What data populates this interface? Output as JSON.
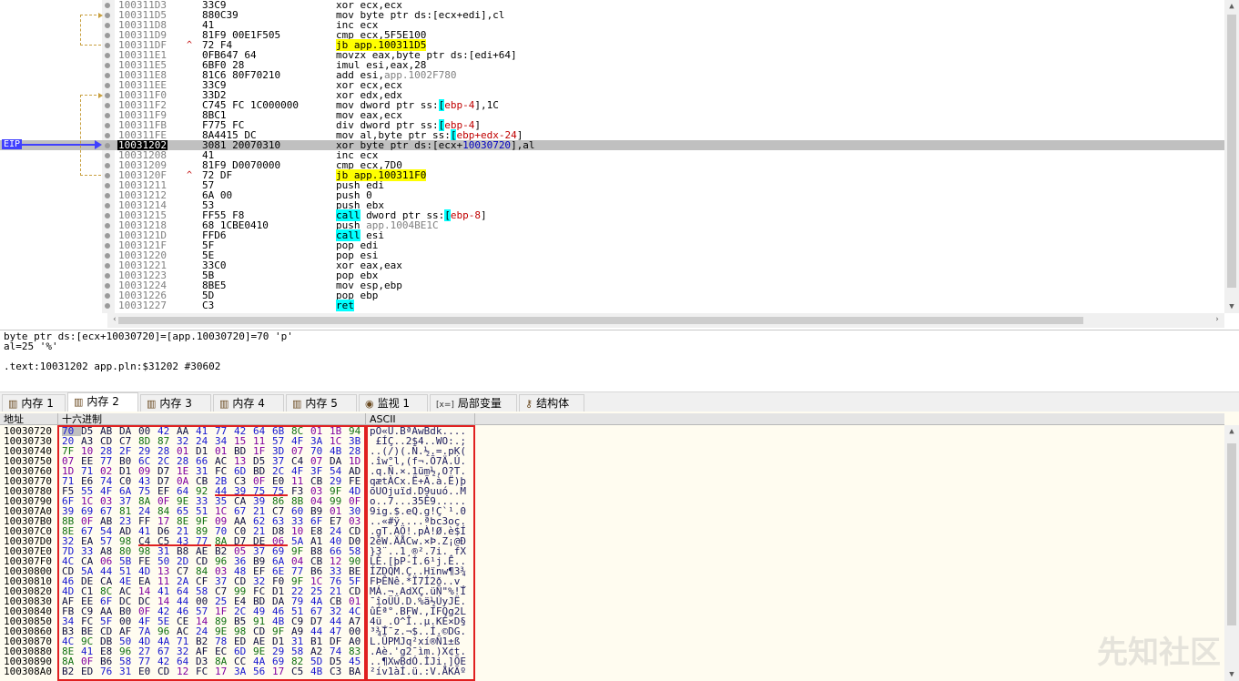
{
  "disasm": {
    "eip_label": "EIP",
    "rows": [
      {
        "addr": "100311D3",
        "bytes": "33C9",
        "asm": [
          {
            "t": "xor ecx,ecx"
          }
        ]
      },
      {
        "addr": "100311D5",
        "bytes": "880C39",
        "asm": [
          {
            "t": "mov byte ptr ds:[ecx+edi],cl"
          }
        ]
      },
      {
        "addr": "100311D8",
        "bytes": "41",
        "asm": [
          {
            "t": "inc ecx"
          }
        ]
      },
      {
        "addr": "100311D9",
        "bytes": "81F9 00E1F505",
        "asm": [
          {
            "t": "cmp ecx,5F5E100"
          }
        ]
      },
      {
        "addr": "100311DF",
        "bytes": "72 F4",
        "asm": [
          {
            "t": "jb app.100311D5",
            "c": "hl-y"
          }
        ],
        "jump": true
      },
      {
        "addr": "100311E1",
        "bytes": "0FB647 64",
        "asm": [
          {
            "t": "movzx eax,byte ptr ds:[edi+64]"
          }
        ]
      },
      {
        "addr": "100311E5",
        "bytes": "6BF0 28",
        "asm": [
          {
            "t": "imul esi,eax,28"
          }
        ]
      },
      {
        "addr": "100311E8",
        "bytes": "81C6 80F70210",
        "asm": [
          {
            "t": "add esi,"
          },
          {
            "t": "app.1002F780",
            "c": "col-gray"
          }
        ]
      },
      {
        "addr": "100311EE",
        "bytes": "33C9",
        "asm": [
          {
            "t": "xor ecx,ecx"
          }
        ]
      },
      {
        "addr": "100311F0",
        "bytes": "33D2",
        "asm": [
          {
            "t": "xor edx,edx"
          }
        ]
      },
      {
        "addr": "100311F2",
        "bytes": "C745 FC 1C000000",
        "asm": [
          {
            "t": "mov dword ptr ss:"
          },
          {
            "t": "[",
            "c": "hl-c"
          },
          {
            "t": "ebp-4",
            "c": "col-r"
          },
          {
            "t": "],1C"
          }
        ]
      },
      {
        "addr": "100311F9",
        "bytes": "8BC1",
        "asm": [
          {
            "t": "mov eax,ecx"
          }
        ]
      },
      {
        "addr": "100311FB",
        "bytes": "F775 FC",
        "asm": [
          {
            "t": "div dword ptr ss:"
          },
          {
            "t": "[",
            "c": "hl-c"
          },
          {
            "t": "ebp-4",
            "c": "col-r"
          },
          {
            "t": "]"
          }
        ]
      },
      {
        "addr": "100311FE",
        "bytes": "8A4415 DC",
        "asm": [
          {
            "t": "mov al,byte ptr ss:"
          },
          {
            "t": "[",
            "c": "hl-c"
          },
          {
            "t": "ebp+edx-24",
            "c": "col-r"
          },
          {
            "t": "]"
          }
        ]
      },
      {
        "addr": "10031202",
        "bytes": "3081 20070310",
        "asm": [
          {
            "t": "xor byte ptr ds:[ecx+"
          },
          {
            "t": "10030720",
            "c": "col-b"
          },
          {
            "t": "],al"
          }
        ],
        "eip": true
      },
      {
        "addr": "10031208",
        "bytes": "41",
        "asm": [
          {
            "t": "inc ecx"
          }
        ]
      },
      {
        "addr": "10031209",
        "bytes": "81F9 D0070000",
        "asm": [
          {
            "t": "cmp ecx,7D0"
          }
        ]
      },
      {
        "addr": "1003120F",
        "bytes": "72 DF",
        "asm": [
          {
            "t": "jb app.100311F0",
            "c": "hl-y"
          }
        ],
        "jump": true
      },
      {
        "addr": "10031211",
        "bytes": "57",
        "asm": [
          {
            "t": "push edi"
          }
        ]
      },
      {
        "addr": "10031212",
        "bytes": "6A 00",
        "asm": [
          {
            "t": "push 0"
          }
        ]
      },
      {
        "addr": "10031214",
        "bytes": "53",
        "asm": [
          {
            "t": "push ebx"
          }
        ]
      },
      {
        "addr": "10031215",
        "bytes": "FF55 F8",
        "asm": [
          {
            "t": "call",
            "c": "hl-c"
          },
          {
            "t": " dword ptr ss:"
          },
          {
            "t": "[",
            "c": "hl-c"
          },
          {
            "t": "ebp-8",
            "c": "col-r"
          },
          {
            "t": "]"
          }
        ]
      },
      {
        "addr": "10031218",
        "bytes": "68 1CBE0410",
        "asm": [
          {
            "t": "push "
          },
          {
            "t": "app.1004BE1C",
            "c": "col-gray"
          }
        ]
      },
      {
        "addr": "1003121D",
        "bytes": "FFD6",
        "asm": [
          {
            "t": "call",
            "c": "hl-c"
          },
          {
            "t": " esi"
          }
        ]
      },
      {
        "addr": "1003121F",
        "bytes": "5F",
        "asm": [
          {
            "t": "pop edi"
          }
        ]
      },
      {
        "addr": "10031220",
        "bytes": "5E",
        "asm": [
          {
            "t": "pop esi"
          }
        ]
      },
      {
        "addr": "10031221",
        "bytes": "33C0",
        "asm": [
          {
            "t": "xor eax,eax"
          }
        ]
      },
      {
        "addr": "10031223",
        "bytes": "5B",
        "asm": [
          {
            "t": "pop ebx"
          }
        ]
      },
      {
        "addr": "10031224",
        "bytes": "8BE5",
        "asm": [
          {
            "t": "mov esp,ebp"
          }
        ]
      },
      {
        "addr": "10031226",
        "bytes": "5D",
        "asm": [
          {
            "t": "pop ebp"
          }
        ]
      },
      {
        "addr": "10031227",
        "bytes": "C3",
        "asm": [
          {
            "t": "ret",
            "c": "hl-c"
          }
        ]
      }
    ]
  },
  "info": {
    "line1": "byte ptr ds:[ecx+10030720]=[app.10030720]=70 'p'",
    "line2": "al=25 '%'",
    "line3": ".text:10031202 app.pln:$31202 #30602"
  },
  "tabs": [
    {
      "label": "内存 1",
      "icon": "memory-icon"
    },
    {
      "label": "内存 2",
      "icon": "memory-icon",
      "active": true
    },
    {
      "label": "内存 3",
      "icon": "memory-icon"
    },
    {
      "label": "内存 4",
      "icon": "memory-icon"
    },
    {
      "label": "内存 5",
      "icon": "memory-icon"
    },
    {
      "label": "监视 1",
      "icon": "watch-icon"
    },
    {
      "label": "局部变量",
      "icon": "locals-icon",
      "prefix": "[x=]"
    },
    {
      "label": "结构体",
      "icon": "struct-icon"
    }
  ],
  "dump": {
    "headers": {
      "address": "地址",
      "hex": "十六进制",
      "ascii": "ASCII"
    },
    "rows": [
      {
        "addr": "10030720",
        "hex": "70 D5 AB DA 00 42 AA 41 77 42 64 6B 8C 01 1B 94",
        "ascii": "pÕ«Ú.BªAwBdk...."
      },
      {
        "addr": "10030730",
        "hex": "20 A3 CD C7 8D 87 32 24 34 15 11 57 4F 3A 1C 3B",
        "ascii": " £ÍÇ..2$4..WO:.;"
      },
      {
        "addr": "10030740",
        "hex": "7F 10 28 2F 29 28 01 D1 01 BD 1F 3D 07 70 4B 28",
        "ascii": "..(/)(.Ñ.½.=.pK("
      },
      {
        "addr": "10030750",
        "hex": "07 EE 77 B0 6C 2C 28 66 AC 13 D5 37 C4 07 DA 1D",
        "ascii": ".îw°l,(f¬.Õ7Ä.Ú."
      },
      {
        "addr": "10030760",
        "hex": "1D 71 02 D1 09 D7 1E 31 FC 6D BD 2C 4F 3F 54 AD",
        "ascii": ".q.Ñ.×.1üm½,O?T."
      },
      {
        "addr": "10030770",
        "hex": "71 E6 74 C0 43 D7 0A CB 2B C3 0F E0 11 CB 29 FE",
        "ascii": "qætÀCx.Ë+Ã.à.Ë)þ"
      },
      {
        "addr": "10030780",
        "hex": "F5 55 4F 6A 75 EF 64 92 44 39 75 75 F3 03 9F 4D",
        "ascii": "õUOjuïd.D9uuó..M"
      },
      {
        "addr": "10030790",
        "hex": "6F 1C 03 37 8A 0F 9E 33 35 CA 39 86 8B 04 99 0F",
        "ascii": "o..7...35Ê9....."
      },
      {
        "addr": "100307A0",
        "hex": "39 69 67 81 24 84 65 51 1C 67 21 C7 60 B9 01 30",
        "ascii": "9ig.$.eQ.g!Ç`¹.0"
      },
      {
        "addr": "100307B0",
        "hex": "8B 0F AB 23 FF 17 8E 9F 09 AA 62 63 33 6F E7 03",
        "ascii": "..«#ÿ....ªbc3oç."
      },
      {
        "addr": "100307C0",
        "hex": "8E 67 54 AD 41 D6 21 89 70 C0 21 D8 10 E8 24 CD",
        "ascii": ".gT.AÖ!.pÀ!Ø.è$Í"
      },
      {
        "addr": "100307D0",
        "hex": "32 EA 57 98 C4 C5 43 77 8A D7 DE 06 5A A1 40 D0",
        "ascii": "2êW.ÄÅCw.×Þ.Z¡@Ð"
      },
      {
        "addr": "100307E0",
        "hex": "7D 33 A8 80 98 31 B8 AE B2 05 37 69 9F B8 66 58",
        "ascii": "}3¨..1¸®².7i.¸fX"
      },
      {
        "addr": "100307F0",
        "hex": "4C CA 06 5B FE 50 2D CD 96 36 B9 6A 04 CB 12 90",
        "ascii": "LÊ.[þP-Í.6¹j.Ë.."
      },
      {
        "addr": "10030800",
        "hex": "CD 5A 44 51 4D 13 C7 84 03 48 EF 6E 77 B6 33 BE",
        "ascii": "ÍZDQM.Ç..Hïnw¶3¾"
      },
      {
        "addr": "10030810",
        "hex": "46 DE CA 4E EA 11 2A CF 37 CD 32 F0 9F 1C 76 5F",
        "ascii": "FÞÊNê.*Ï7Í2ð..v_"
      },
      {
        "addr": "10030820",
        "hex": "4D C1 8C AC 14 41 64 58 C7 99 FC D1 22 25 21 CD",
        "ascii": "MÁ.¬.AdXÇ.üÑ\"%!Í"
      },
      {
        "addr": "10030830",
        "hex": "AF EE 6F DC DC 14 44 00 25 E4 BD DA 79 4A CB 01",
        "ascii": "¯îoÜÜ.D.%ä½ÚyJË."
      },
      {
        "addr": "10030840",
        "hex": "FB C9 AA B0 0F 42 46 57 1F 2C 49 46 51 67 32 4C",
        "ascii": "ûÉª°.BFW.,IFQg2L"
      },
      {
        "addr": "10030850",
        "hex": "34 FC 5F 00 4F 5E CE 14 89 B5 91 4B C9 D7 44 A7",
        "ascii": "4ü_.O^Î..µ.KÉ×D§"
      },
      {
        "addr": "10030860",
        "hex": "B3 BE CD AF 7A 96 AC 24 9E 98 CD 9F A9 44 47 00",
        "ascii": "³¾Í¯z.¬$..Í.©DG."
      },
      {
        "addr": "10030870",
        "hex": "4C 9C DB 50 4D 4A 71 B2 78 ED AE D1 31 B1 DF A0",
        "ascii": "L.ÛPMJq²xí®Ñ1±ß "
      },
      {
        "addr": "10030880",
        "hex": "8E 41 E8 96 27 67 32 AF EC 6D 9E 29 58 A2 74 83",
        "ascii": ".Aè.'g2¯ìm.)X¢t."
      },
      {
        "addr": "10030890",
        "hex": "8A 0F B6 58 77 42 64 D3 8A CC 4A 69 82 5D D5 45",
        "ascii": "..¶XwBdÓ.ÌJi.]ÕE"
      },
      {
        "addr": "100308A0",
        "hex": "B2 ED 76 31 E0 CD 12 FC 17 3A 56 17 C5 4B C3 BA",
        "ascii": "²ív1àÍ.ü.:V.ÅKÃº"
      }
    ]
  },
  "watermark": "先知社区"
}
